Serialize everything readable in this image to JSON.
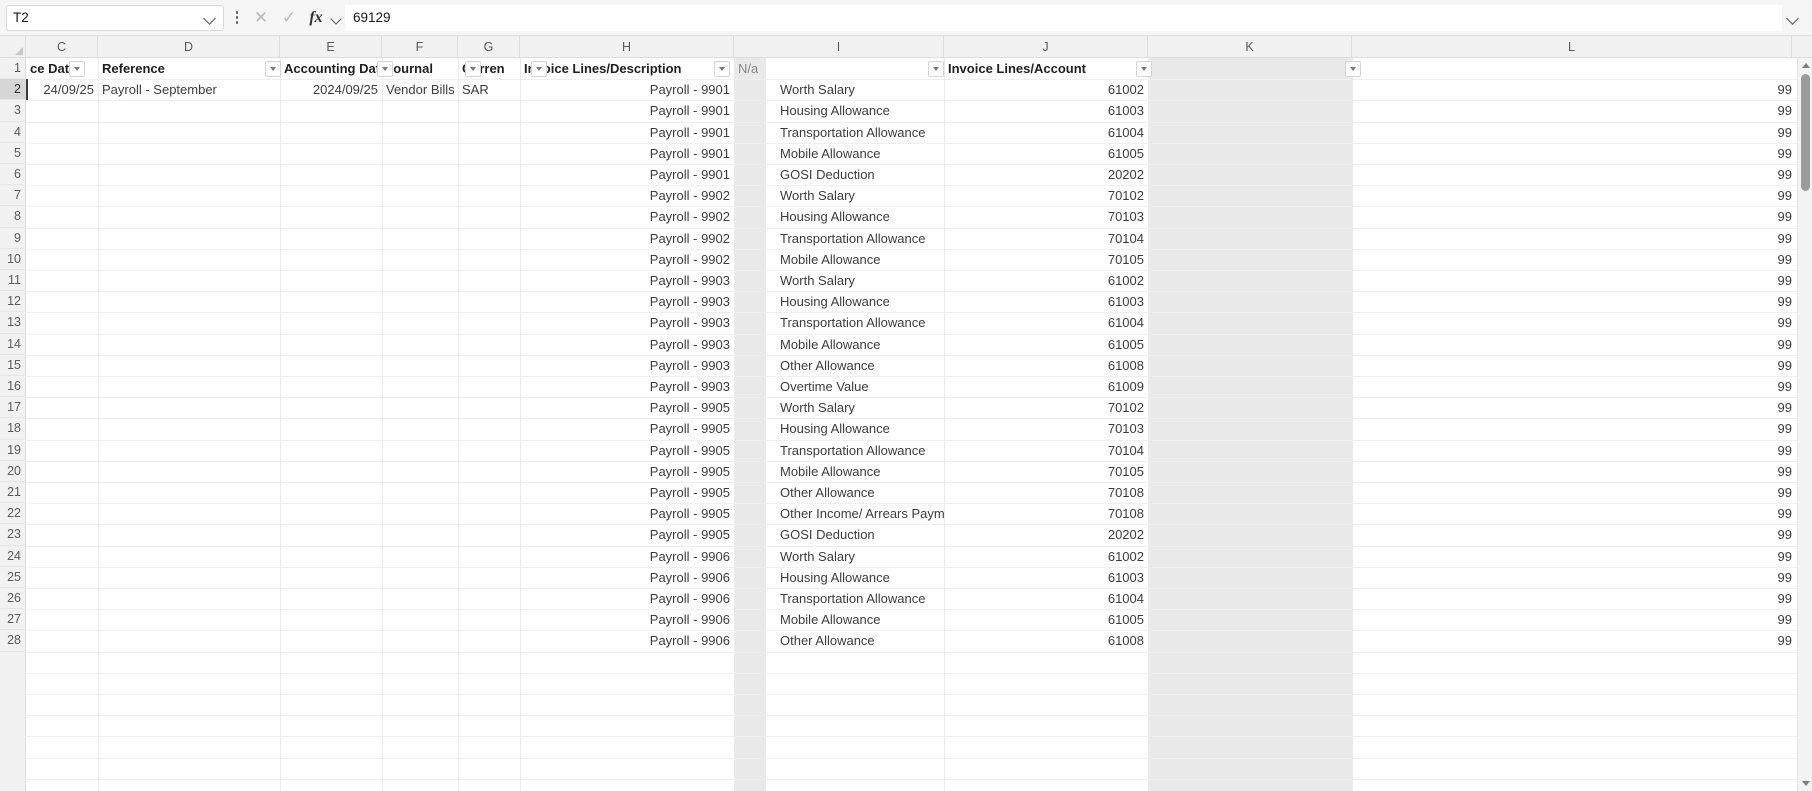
{
  "app": {
    "type": "spreadsheet"
  },
  "formula_bar": {
    "name_box_value": "T2",
    "name_box_icon": "chevron-down-icon",
    "menu_icon": "kebab-menu-icon",
    "cancel_icon": "✕",
    "accept_icon": "✓",
    "function_icon": "fx",
    "function_chevron_icon": "chevron-down-icon",
    "formula_value": "69129",
    "formula_placeholder": "",
    "expand_icon": "chevron-down-icon"
  },
  "grid": {
    "column_letters": [
      "C",
      "D",
      "E",
      "F",
      "G",
      "H",
      "I",
      "J",
      "K",
      "L"
    ],
    "row_numbers": [
      1,
      2,
      3,
      4,
      5,
      6,
      7,
      8,
      9,
      10,
      11,
      12,
      13,
      14,
      15,
      16,
      17,
      18,
      19,
      20,
      21,
      22,
      23,
      24,
      25,
      26,
      27,
      28
    ],
    "selected_row": 2,
    "headers": {
      "C": "ce Dat",
      "D": "Reference",
      "E": "Accounting Dat",
      "F": "Journal",
      "G": "Curren",
      "H": "Invoice Lines/Description",
      "I": "N/a",
      "J": "Invoice Lines/Account",
      "K": "",
      "L": ""
    },
    "rows": [
      {
        "n": 2,
        "C": "24/09/25",
        "D": "Payroll - September",
        "E": "2024/09/25",
        "F": "Vendor Bills",
        "G": "SAR",
        "H": "Payroll - 9901",
        "I": "Worth Salary",
        "J": "61002",
        "L": "99"
      },
      {
        "n": 3,
        "C": "",
        "D": "",
        "E": "",
        "F": "",
        "G": "",
        "H": "Payroll - 9901",
        "I": "Housing Allowance",
        "J": "61003",
        "L": "99"
      },
      {
        "n": 4,
        "C": "",
        "D": "",
        "E": "",
        "F": "",
        "G": "",
        "H": "Payroll - 9901",
        "I": "Transportation Allowance",
        "J": "61004",
        "L": "99"
      },
      {
        "n": 5,
        "C": "",
        "D": "",
        "E": "",
        "F": "",
        "G": "",
        "H": "Payroll - 9901",
        "I": "Mobile Allowance",
        "J": "61005",
        "L": "99"
      },
      {
        "n": 6,
        "C": "",
        "D": "",
        "E": "",
        "F": "",
        "G": "",
        "H": "Payroll - 9901",
        "I": "GOSI Deduction",
        "J": "20202",
        "L": "99"
      },
      {
        "n": 7,
        "C": "",
        "D": "",
        "E": "",
        "F": "",
        "G": "",
        "H": "Payroll - 9902",
        "I": "Worth Salary",
        "J": "70102",
        "L": "99"
      },
      {
        "n": 8,
        "C": "",
        "D": "",
        "E": "",
        "F": "",
        "G": "",
        "H": "Payroll - 9902",
        "I": "Housing Allowance",
        "J": "70103",
        "L": "99"
      },
      {
        "n": 9,
        "C": "",
        "D": "",
        "E": "",
        "F": "",
        "G": "",
        "H": "Payroll - 9902",
        "I": "Transportation Allowance",
        "J": "70104",
        "L": "99"
      },
      {
        "n": 10,
        "C": "",
        "D": "",
        "E": "",
        "F": "",
        "G": "",
        "H": "Payroll - 9902",
        "I": "Mobile Allowance",
        "J": "70105",
        "L": "99"
      },
      {
        "n": 11,
        "C": "",
        "D": "",
        "E": "",
        "F": "",
        "G": "",
        "H": "Payroll - 9903",
        "I": "Worth Salary",
        "J": "61002",
        "L": "99"
      },
      {
        "n": 12,
        "C": "",
        "D": "",
        "E": "",
        "F": "",
        "G": "",
        "H": "Payroll - 9903",
        "I": "Housing Allowance",
        "J": "61003",
        "L": "99"
      },
      {
        "n": 13,
        "C": "",
        "D": "",
        "E": "",
        "F": "",
        "G": "",
        "H": "Payroll - 9903",
        "I": "Transportation Allowance",
        "J": "61004",
        "L": "99"
      },
      {
        "n": 14,
        "C": "",
        "D": "",
        "E": "",
        "F": "",
        "G": "",
        "H": "Payroll - 9903",
        "I": "Mobile Allowance",
        "J": "61005",
        "L": "99"
      },
      {
        "n": 15,
        "C": "",
        "D": "",
        "E": "",
        "F": "",
        "G": "",
        "H": "Payroll - 9903",
        "I": "Other Allowance",
        "J": "61008",
        "L": "99"
      },
      {
        "n": 16,
        "C": "",
        "D": "",
        "E": "",
        "F": "",
        "G": "",
        "H": "Payroll - 9903",
        "I": "Overtime Value",
        "J": "61009",
        "L": "99"
      },
      {
        "n": 17,
        "C": "",
        "D": "",
        "E": "",
        "F": "",
        "G": "",
        "H": "Payroll - 9905",
        "I": "Worth Salary",
        "J": "70102",
        "L": "99"
      },
      {
        "n": 18,
        "C": "",
        "D": "",
        "E": "",
        "F": "",
        "G": "",
        "H": "Payroll - 9905",
        "I": "Housing Allowance",
        "J": "70103",
        "L": "99"
      },
      {
        "n": 19,
        "C": "",
        "D": "",
        "E": "",
        "F": "",
        "G": "",
        "H": "Payroll - 9905",
        "I": "Transportation Allowance",
        "J": "70104",
        "L": "99"
      },
      {
        "n": 20,
        "C": "",
        "D": "",
        "E": "",
        "F": "",
        "G": "",
        "H": "Payroll - 9905",
        "I": "Mobile Allowance",
        "J": "70105",
        "L": "99"
      },
      {
        "n": 21,
        "C": "",
        "D": "",
        "E": "",
        "F": "",
        "G": "",
        "H": "Payroll - 9905",
        "I": "Other Allowance",
        "J": "70108",
        "L": "99"
      },
      {
        "n": 22,
        "C": "",
        "D": "",
        "E": "",
        "F": "",
        "G": "",
        "H": "Payroll - 9905",
        "I": "Other Income/ Arrears Payment",
        "J": "70108",
        "L": "99"
      },
      {
        "n": 23,
        "C": "",
        "D": "",
        "E": "",
        "F": "",
        "G": "",
        "H": "Payroll - 9905",
        "I": "GOSI Deduction",
        "J": "20202",
        "L": "99"
      },
      {
        "n": 24,
        "C": "",
        "D": "",
        "E": "",
        "F": "",
        "G": "",
        "H": "Payroll - 9906",
        "I": "Worth Salary",
        "J": "61002",
        "L": "99"
      },
      {
        "n": 25,
        "C": "",
        "D": "",
        "E": "",
        "F": "",
        "G": "",
        "H": "Payroll - 9906",
        "I": "Housing Allowance",
        "J": "61003",
        "L": "99"
      },
      {
        "n": 26,
        "C": "",
        "D": "",
        "E": "",
        "F": "",
        "G": "",
        "H": "Payroll - 9906",
        "I": "Transportation Allowance",
        "J": "61004",
        "L": "99"
      },
      {
        "n": 27,
        "C": "",
        "D": "",
        "E": "",
        "F": "",
        "G": "",
        "H": "Payroll - 9906",
        "I": "Mobile Allowance",
        "J": "61005",
        "L": "99"
      },
      {
        "n": 28,
        "C": "",
        "D": "",
        "E": "",
        "F": "",
        "G": "",
        "H": "Payroll - 9906",
        "I": "Other Allowance",
        "J": "61008",
        "L": "99"
      }
    ]
  },
  "scrollbar": {
    "up_icon": "triangle-up-icon",
    "down_icon": "triangle-down-icon",
    "thumb": "scroll-thumb"
  },
  "colors": {
    "header_bg": "#f1f1f1",
    "selected_row_bg": "#d6d6d6",
    "band_grey": "#e9e9e9",
    "grid_line": "#efefef",
    "text": "#3c3c3c"
  }
}
